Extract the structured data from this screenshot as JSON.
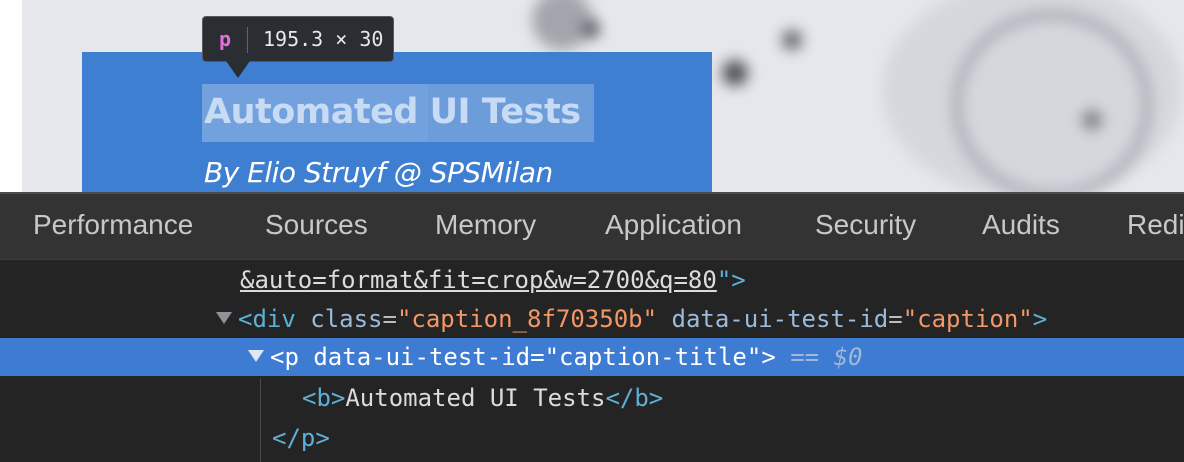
{
  "inspector_tooltip": {
    "tag": "p",
    "dimensions": "195.3 × 30"
  },
  "caption": {
    "title": "Automated UI Tests",
    "subtitle": "By Elio Struyf @ SPSMilan"
  },
  "devtools": {
    "tabs": [
      "Performance",
      "Sources",
      "Memory",
      "Application",
      "Security",
      "Audits",
      "Redi"
    ],
    "tree": {
      "line1_url": "&auto=format&fit=crop&w=2700&q=80",
      "line1_close": "\">",
      "div_open": "<div",
      "div_class_attr": "class",
      "div_class_value": "\"caption_8f70350b\"",
      "div_test_attr": "data-ui-test-id",
      "div_test_value": "\"caption\"",
      "p_open": "<p",
      "p_test_attr": "data-ui-test-id",
      "p_test_value": "\"caption-title\"",
      "p_close_bracket": ">",
      "selected_marker": "== $0",
      "b_open": "<b>",
      "b_text": "Automated UI Tests",
      "b_close": "</b>",
      "p_close": "</p>"
    }
  },
  "colors": {
    "caption_bg": "#3f7fd2",
    "selected_row": "#3e7bd2",
    "tag": "#5db0d7",
    "attr_value": "#f29766"
  }
}
